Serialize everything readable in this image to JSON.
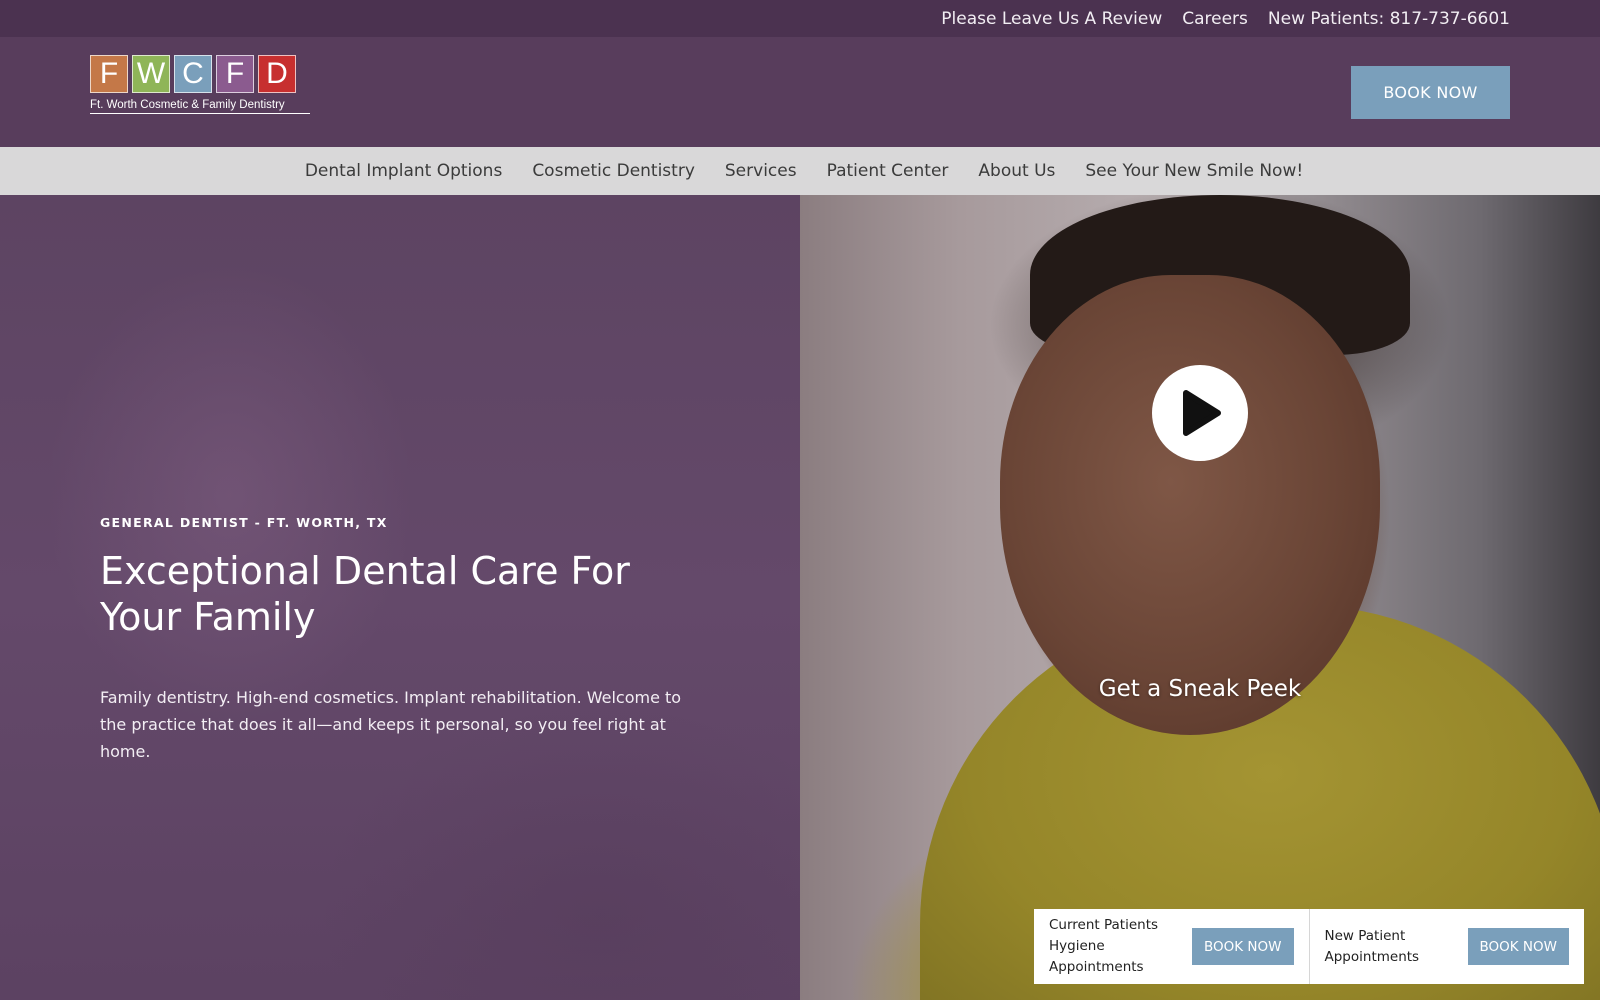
{
  "utility_bar": {
    "review_link": "Please Leave Us A Review",
    "careers_link": "Careers",
    "phone_text": "New Patients: 817-737-6601"
  },
  "header": {
    "logo": {
      "letters": [
        "F",
        "W",
        "C",
        "F",
        "D"
      ],
      "colors": [
        "#c47848",
        "#8fb558",
        "#7a9fbb",
        "#8b5b8f",
        "#c72f2f"
      ],
      "caption": "Ft. Worth Cosmetic & Family Dentistry"
    },
    "book_now": "BOOK NOW"
  },
  "nav": {
    "items": [
      "Dental Implant Options",
      "Cosmetic Dentistry",
      "Services",
      "Patient Center",
      "About Us",
      "See Your New Smile Now!"
    ]
  },
  "hero": {
    "eyebrow": "GENERAL DENTIST - FT. WORTH, TX",
    "title": "Exceptional Dental Care For Your Family",
    "description": "Family dentistry. High-end cosmetics. Implant rehabilitation. Welcome to the practice that does it all—and keeps it personal, so you feel right at home.",
    "video_label": "Get a Sneak Peek"
  },
  "booking": {
    "current": {
      "label": "Current Patients\nHygiene Appointments",
      "button": "BOOK NOW"
    },
    "new": {
      "label": "New Patient\nAppointments",
      "button": "BOOK NOW"
    }
  },
  "colors": {
    "accent_blue": "#7a9fbb",
    "header_purple": "#583d5c",
    "utility_purple": "#4b3250",
    "nav_gray": "#d9d8d9"
  }
}
